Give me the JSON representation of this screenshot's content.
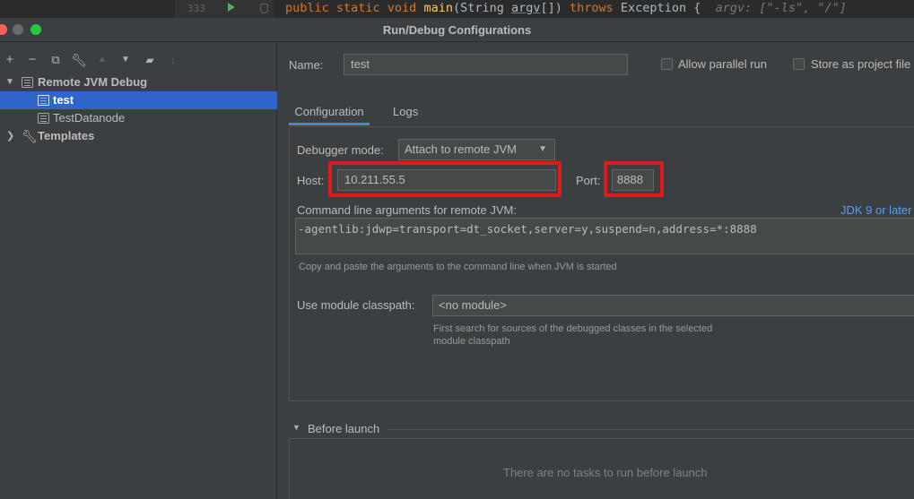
{
  "editor": {
    "line_number": "333",
    "code": {
      "kw1": "public static void ",
      "fn": "main",
      "p1": "(String ",
      "arg": "argv",
      "p2": "[]) ",
      "kw2": "throws ",
      "p3": "Exception {",
      "hint": "  argv: [\"-ls\", \"/\"]"
    }
  },
  "dialog": {
    "title": "Run/Debug Configurations"
  },
  "tree": {
    "groups": [
      {
        "label": "Remote JVM Debug",
        "expanded": true,
        "children": [
          "test",
          "TestDatanode"
        ]
      },
      {
        "label": "Templates",
        "expanded": false
      }
    ],
    "selected": "test"
  },
  "form": {
    "name_label": "Name:",
    "name_value": "test",
    "allow_parallel_label": "Allow parallel run",
    "store_project_label": "Store as project file",
    "tabs": [
      "Configuration",
      "Logs"
    ],
    "active_tab": "Configuration",
    "debugger_mode_label": "Debugger mode:",
    "debugger_mode_value": "Attach to remote JVM",
    "host_label": "Host:",
    "host_value": "10.211.55.5",
    "port_label": "Port:",
    "port_value": "8888",
    "cmdline_label": "Command line arguments for remote JVM:",
    "jdk_link": "JDK 9 or later",
    "cmdline_value": "-agentlib:jdwp=transport=dt_socket,server=y,suspend=n,address=*:8888",
    "cmdline_hint": "Copy and paste the arguments to the command line when JVM is started",
    "module_label": "Use module classpath:",
    "module_value": "<no module>",
    "module_hint_1": "First search for sources of the debugged classes in the selected",
    "module_hint_2": "module classpath",
    "before_launch_label": "Before launch",
    "no_tasks": "There are no tasks to run before launch"
  },
  "colors": {
    "highlight_border": "#e0191d",
    "selection": "#2f65ca",
    "link": "#589df6",
    "traffic_red": "#fe5f57",
    "traffic_gray": "#6a6a6a",
    "traffic_green": "#28c840"
  }
}
